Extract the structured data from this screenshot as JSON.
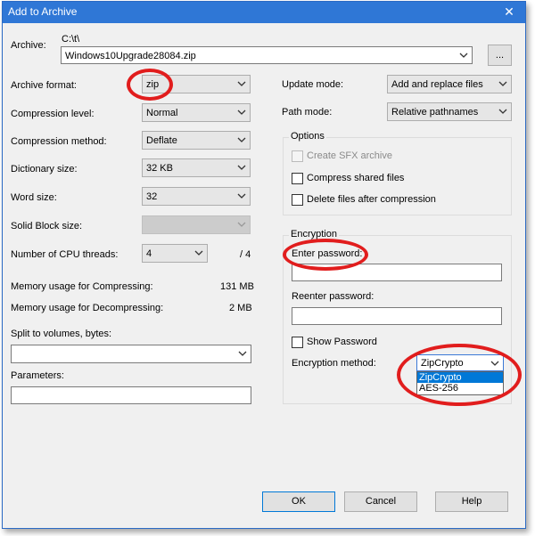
{
  "window": {
    "title": "Add to Archive",
    "close_glyph": "✕"
  },
  "archive": {
    "label": "Archive:",
    "path": "C:\\t\\",
    "filename": "Windows10Upgrade28084.zip",
    "browse_label": "..."
  },
  "left": {
    "archive_format": {
      "label": "Archive format:",
      "value": "zip"
    },
    "compression_level": {
      "label": "Compression level:",
      "value": "Normal"
    },
    "compression_method": {
      "label": "Compression method:",
      "value": "Deflate"
    },
    "dictionary_size": {
      "label": "Dictionary size:",
      "value": "32 KB"
    },
    "word_size": {
      "label": "Word size:",
      "value": "32"
    },
    "solid_block_size": {
      "label": "Solid Block size:",
      "value": ""
    },
    "cpu_threads": {
      "label": "Number of CPU threads:",
      "value": "4",
      "max": "/ 4"
    },
    "mem_compress": {
      "label": "Memory usage for Compressing:",
      "value": "131 MB"
    },
    "mem_decompress": {
      "label": "Memory usage for Decompressing:",
      "value": "2 MB"
    },
    "split": {
      "label": "Split to volumes, bytes:",
      "value": ""
    },
    "parameters": {
      "label": "Parameters:",
      "value": ""
    }
  },
  "right": {
    "update_mode": {
      "label": "Update mode:",
      "value": "Add and replace files"
    },
    "path_mode": {
      "label": "Path mode:",
      "value": "Relative pathnames"
    },
    "options": {
      "title": "Options",
      "create_sfx": "Create SFX archive",
      "compress_shared": "Compress shared files",
      "delete_after": "Delete files after compression"
    },
    "encryption": {
      "title": "Encryption",
      "enter_password": "Enter password:",
      "reenter_password": "Reenter password:",
      "show_password": "Show Password",
      "method_label": "Encryption method:",
      "method_value": "ZipCrypto",
      "method_options": [
        "ZipCrypto",
        "AES-256"
      ]
    }
  },
  "buttons": {
    "ok": "OK",
    "cancel": "Cancel",
    "help": "Help"
  },
  "colors": {
    "accent": "#2f77d6",
    "highlight_ring": "#e11d1d",
    "selection": "#0078d7"
  },
  "icons": {
    "combo_arrow": "chevron-down-icon",
    "close": "close-icon"
  }
}
